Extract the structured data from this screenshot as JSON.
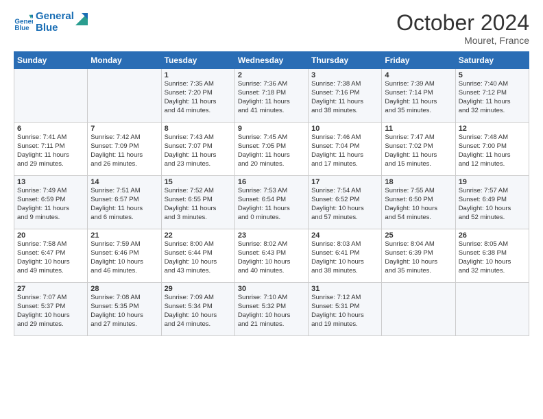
{
  "logo": {
    "line1": "General",
    "line2": "Blue"
  },
  "title": "October 2024",
  "location": "Mouret, France",
  "days_header": [
    "Sunday",
    "Monday",
    "Tuesday",
    "Wednesday",
    "Thursday",
    "Friday",
    "Saturday"
  ],
  "weeks": [
    [
      {
        "day": "",
        "content": ""
      },
      {
        "day": "",
        "content": ""
      },
      {
        "day": "1",
        "content": "Sunrise: 7:35 AM\nSunset: 7:20 PM\nDaylight: 11 hours\nand 44 minutes."
      },
      {
        "day": "2",
        "content": "Sunrise: 7:36 AM\nSunset: 7:18 PM\nDaylight: 11 hours\nand 41 minutes."
      },
      {
        "day": "3",
        "content": "Sunrise: 7:38 AM\nSunset: 7:16 PM\nDaylight: 11 hours\nand 38 minutes."
      },
      {
        "day": "4",
        "content": "Sunrise: 7:39 AM\nSunset: 7:14 PM\nDaylight: 11 hours\nand 35 minutes."
      },
      {
        "day": "5",
        "content": "Sunrise: 7:40 AM\nSunset: 7:12 PM\nDaylight: 11 hours\nand 32 minutes."
      }
    ],
    [
      {
        "day": "6",
        "content": "Sunrise: 7:41 AM\nSunset: 7:11 PM\nDaylight: 11 hours\nand 29 minutes."
      },
      {
        "day": "7",
        "content": "Sunrise: 7:42 AM\nSunset: 7:09 PM\nDaylight: 11 hours\nand 26 minutes."
      },
      {
        "day": "8",
        "content": "Sunrise: 7:43 AM\nSunset: 7:07 PM\nDaylight: 11 hours\nand 23 minutes."
      },
      {
        "day": "9",
        "content": "Sunrise: 7:45 AM\nSunset: 7:05 PM\nDaylight: 11 hours\nand 20 minutes."
      },
      {
        "day": "10",
        "content": "Sunrise: 7:46 AM\nSunset: 7:04 PM\nDaylight: 11 hours\nand 17 minutes."
      },
      {
        "day": "11",
        "content": "Sunrise: 7:47 AM\nSunset: 7:02 PM\nDaylight: 11 hours\nand 15 minutes."
      },
      {
        "day": "12",
        "content": "Sunrise: 7:48 AM\nSunset: 7:00 PM\nDaylight: 11 hours\nand 12 minutes."
      }
    ],
    [
      {
        "day": "13",
        "content": "Sunrise: 7:49 AM\nSunset: 6:59 PM\nDaylight: 11 hours\nand 9 minutes."
      },
      {
        "day": "14",
        "content": "Sunrise: 7:51 AM\nSunset: 6:57 PM\nDaylight: 11 hours\nand 6 minutes."
      },
      {
        "day": "15",
        "content": "Sunrise: 7:52 AM\nSunset: 6:55 PM\nDaylight: 11 hours\nand 3 minutes."
      },
      {
        "day": "16",
        "content": "Sunrise: 7:53 AM\nSunset: 6:54 PM\nDaylight: 11 hours\nand 0 minutes."
      },
      {
        "day": "17",
        "content": "Sunrise: 7:54 AM\nSunset: 6:52 PM\nDaylight: 10 hours\nand 57 minutes."
      },
      {
        "day": "18",
        "content": "Sunrise: 7:55 AM\nSunset: 6:50 PM\nDaylight: 10 hours\nand 54 minutes."
      },
      {
        "day": "19",
        "content": "Sunrise: 7:57 AM\nSunset: 6:49 PM\nDaylight: 10 hours\nand 52 minutes."
      }
    ],
    [
      {
        "day": "20",
        "content": "Sunrise: 7:58 AM\nSunset: 6:47 PM\nDaylight: 10 hours\nand 49 minutes."
      },
      {
        "day": "21",
        "content": "Sunrise: 7:59 AM\nSunset: 6:46 PM\nDaylight: 10 hours\nand 46 minutes."
      },
      {
        "day": "22",
        "content": "Sunrise: 8:00 AM\nSunset: 6:44 PM\nDaylight: 10 hours\nand 43 minutes."
      },
      {
        "day": "23",
        "content": "Sunrise: 8:02 AM\nSunset: 6:43 PM\nDaylight: 10 hours\nand 40 minutes."
      },
      {
        "day": "24",
        "content": "Sunrise: 8:03 AM\nSunset: 6:41 PM\nDaylight: 10 hours\nand 38 minutes."
      },
      {
        "day": "25",
        "content": "Sunrise: 8:04 AM\nSunset: 6:39 PM\nDaylight: 10 hours\nand 35 minutes."
      },
      {
        "day": "26",
        "content": "Sunrise: 8:05 AM\nSunset: 6:38 PM\nDaylight: 10 hours\nand 32 minutes."
      }
    ],
    [
      {
        "day": "27",
        "content": "Sunrise: 7:07 AM\nSunset: 5:37 PM\nDaylight: 10 hours\nand 29 minutes."
      },
      {
        "day": "28",
        "content": "Sunrise: 7:08 AM\nSunset: 5:35 PM\nDaylight: 10 hours\nand 27 minutes."
      },
      {
        "day": "29",
        "content": "Sunrise: 7:09 AM\nSunset: 5:34 PM\nDaylight: 10 hours\nand 24 minutes."
      },
      {
        "day": "30",
        "content": "Sunrise: 7:10 AM\nSunset: 5:32 PM\nDaylight: 10 hours\nand 21 minutes."
      },
      {
        "day": "31",
        "content": "Sunrise: 7:12 AM\nSunset: 5:31 PM\nDaylight: 10 hours\nand 19 minutes."
      },
      {
        "day": "",
        "content": ""
      },
      {
        "day": "",
        "content": ""
      }
    ]
  ]
}
